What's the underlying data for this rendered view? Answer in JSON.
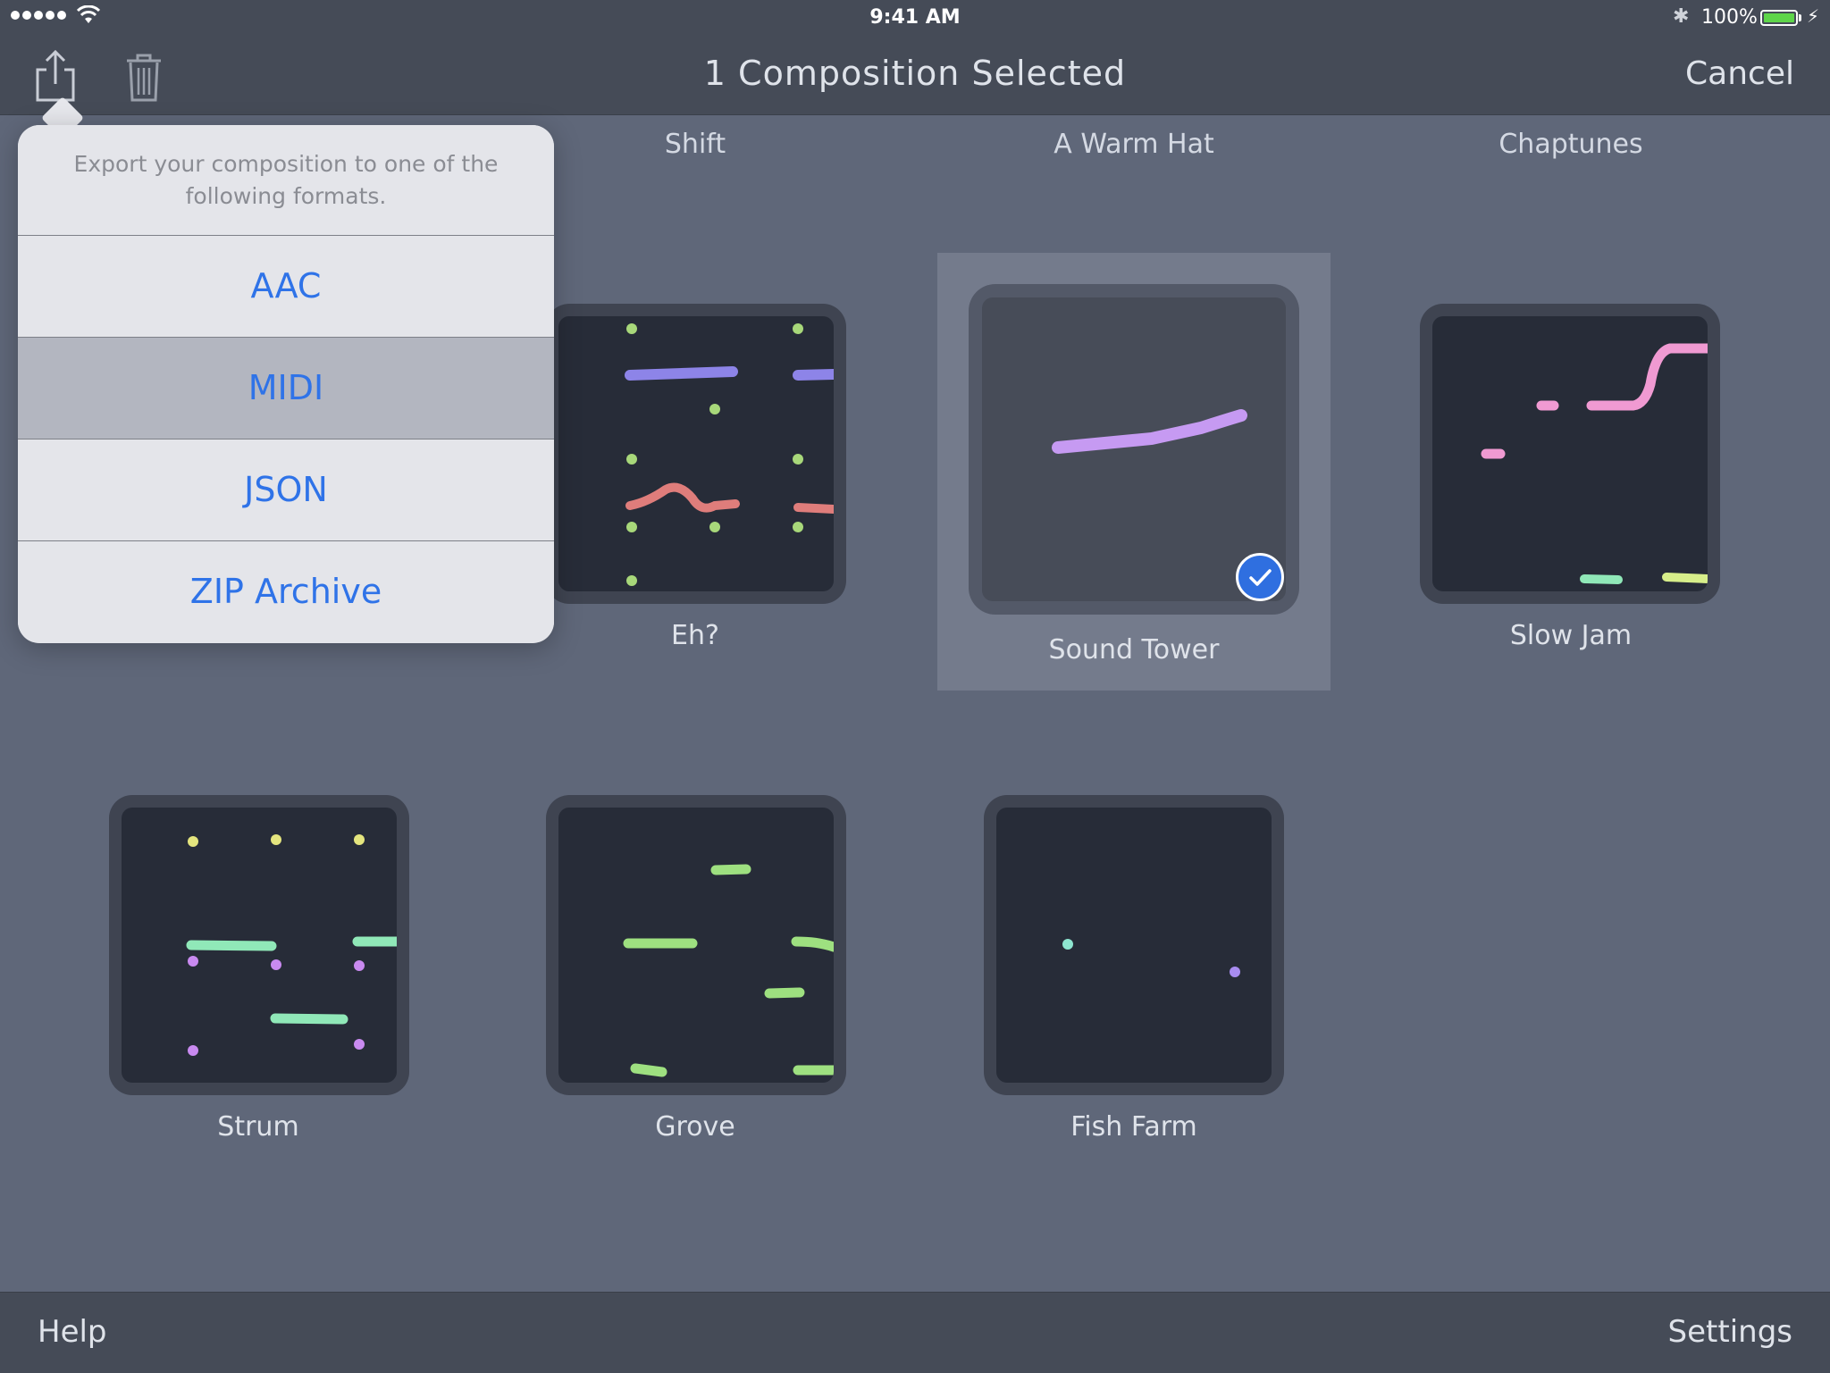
{
  "status_bar": {
    "time": "9:41 AM",
    "battery_percent": "100%",
    "bluetooth_icon": "bluetooth-icon",
    "battery_level": 1.0
  },
  "nav": {
    "title": "1 Composition Selected",
    "cancel_label": "Cancel",
    "share_icon": "share-icon",
    "trash_icon": "trash-icon"
  },
  "column_labels": [
    "Shift",
    "A Warm Hat",
    "Chaptunes"
  ],
  "compositions": [
    {
      "name": "Eh?",
      "selected": false
    },
    {
      "name": "Sound Tower",
      "selected": true
    },
    {
      "name": "Slow Jam",
      "selected": false
    },
    {
      "name": "Strum",
      "selected": false
    },
    {
      "name": "Grove",
      "selected": false
    },
    {
      "name": "Fish Farm",
      "selected": false
    }
  ],
  "popover": {
    "message": "Export your composition to one of the following formats.",
    "options": [
      "AAC",
      "MIDI",
      "JSON",
      "ZIP Archive"
    ],
    "highlighted": "MIDI"
  },
  "bottom_bar": {
    "help_label": "Help",
    "settings_label": "Settings"
  },
  "colors": {
    "accent": "#2f73e8",
    "background": "#5f6779",
    "bar": "#454b57",
    "note_purple": "#9d8bf0",
    "note_red": "#e07f7f",
    "note_green": "#9ee080",
    "note_pink": "#f09ad2",
    "note_mint": "#90e8b8"
  }
}
